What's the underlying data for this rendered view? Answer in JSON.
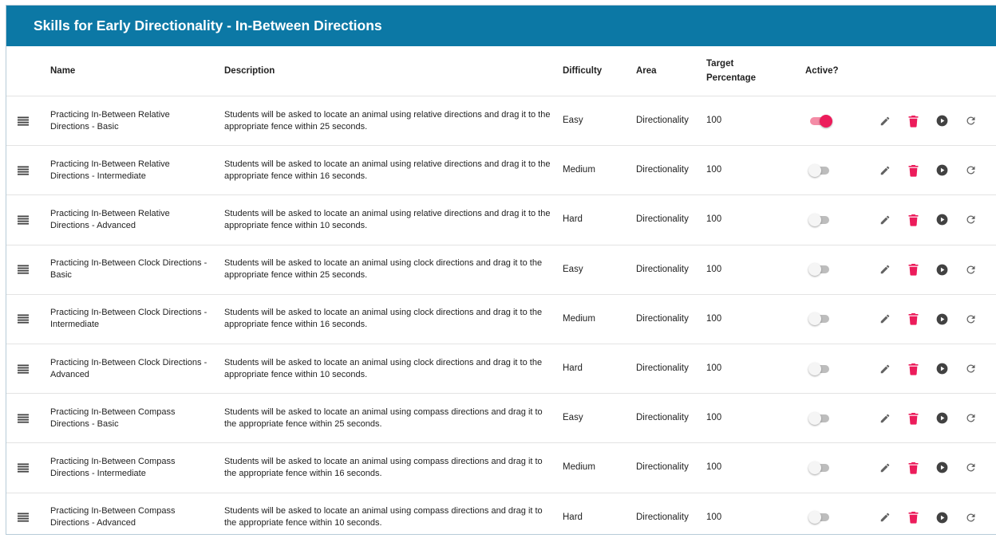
{
  "header": {
    "title": "Skills for Early Directionality - In-Between Directions"
  },
  "columns": {
    "name": "Name",
    "description": "Description",
    "difficulty": "Difficulty",
    "area": "Area",
    "target_line1": "Target",
    "target_line2": "Percentage",
    "active": "Active?"
  },
  "colors": {
    "header_bg": "#0c78a5",
    "toggle_on": "#ec1c5b",
    "delete_icon": "#ec1c5b",
    "action_icon": "#616161"
  },
  "icons": [
    "drag-handle-icon",
    "edit-pencil-icon",
    "delete-trash-icon",
    "play-circle-icon",
    "reset-refresh-icon"
  ],
  "rows": [
    {
      "name": "Practicing In-Between Relative Directions - Basic",
      "description": "Students will be asked to locate an animal using relative directions and drag it to the appropriate fence within 25 seconds.",
      "difficulty": "Easy",
      "area": "Directionality",
      "target": "100",
      "active": true
    },
    {
      "name": "Practicing In-Between Relative Directions - Intermediate",
      "description": "Students will be asked to locate an animal using relative directions and drag it to the appropriate fence within 16 seconds.",
      "difficulty": "Medium",
      "area": "Directionality",
      "target": "100",
      "active": false
    },
    {
      "name": "Practicing In-Between Relative Directions - Advanced",
      "description": "Students will be asked to locate an animal using relative directions and drag it to the appropriate fence within 10 seconds.",
      "difficulty": "Hard",
      "area": "Directionality",
      "target": "100",
      "active": false
    },
    {
      "name": "Practicing In-Between Clock Directions - Basic",
      "description": "Students will be asked to locate an animal using clock directions and drag it to the appropriate fence within 25 seconds.",
      "difficulty": "Easy",
      "area": "Directionality",
      "target": "100",
      "active": false
    },
    {
      "name": "Practicing In-Between Clock Directions - Intermediate",
      "description": "Students will be asked to locate an animal using clock directions and drag it to the appropriate fence within 16 seconds.",
      "difficulty": "Medium",
      "area": "Directionality",
      "target": "100",
      "active": false
    },
    {
      "name": "Practicing In-Between Clock Directions - Advanced",
      "description": "Students will be asked to locate an animal using clock directions and drag it to the appropriate fence within 10 seconds.",
      "difficulty": "Hard",
      "area": "Directionality",
      "target": "100",
      "active": false
    },
    {
      "name": "Practicing In-Between Compass Directions - Basic",
      "description": "Students will be asked to locate an animal using compass directions and drag it to the appropriate fence within 25 seconds.",
      "difficulty": "Easy",
      "area": "Directionality",
      "target": "100",
      "active": false
    },
    {
      "name": "Practicing In-Between Compass Directions - Intermediate",
      "description": "Students will be asked to locate an animal using compass directions and drag it to the appropriate fence within 16 seconds.",
      "difficulty": "Medium",
      "area": "Directionality",
      "target": "100",
      "active": false
    },
    {
      "name": "Practicing In-Between Compass Directions - Advanced",
      "description": "Students will be asked to locate an animal using compass directions and drag it to the appropriate fence within 10 seconds.",
      "difficulty": "Hard",
      "area": "Directionality",
      "target": "100",
      "active": false
    }
  ]
}
